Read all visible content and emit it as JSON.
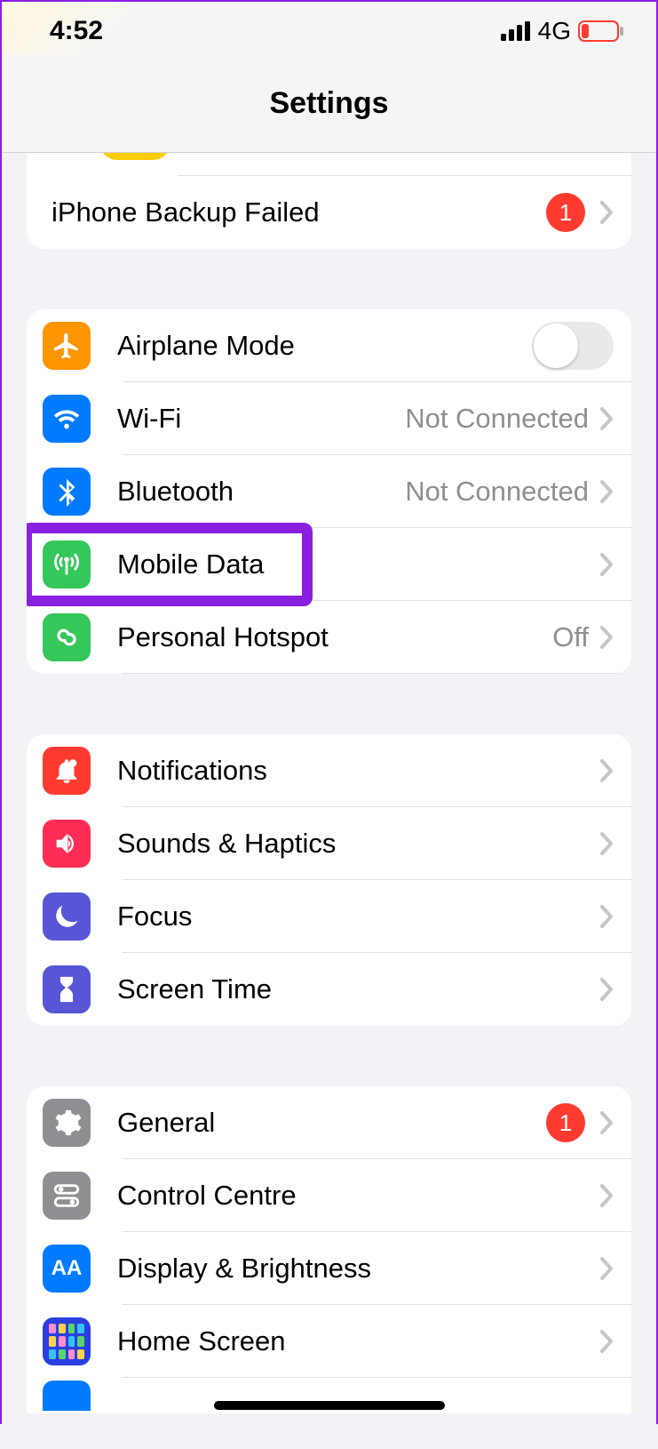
{
  "status_bar": {
    "time": "4:52",
    "network_label": "4G"
  },
  "header": {
    "title": "Settings"
  },
  "first_group": {
    "backup": {
      "label": "iPhone Backup Failed",
      "badge": "1"
    }
  },
  "connectivity": {
    "airplane": {
      "label": "Airplane Mode"
    },
    "wifi": {
      "label": "Wi-Fi",
      "value": "Not Connected"
    },
    "bluetooth": {
      "label": "Bluetooth",
      "value": "Not Connected"
    },
    "mobile": {
      "label": "Mobile Data"
    },
    "hotspot": {
      "label": "Personal Hotspot",
      "value": "Off"
    }
  },
  "alerts": {
    "notifications": {
      "label": "Notifications"
    },
    "sounds": {
      "label": "Sounds & Haptics"
    },
    "focus": {
      "label": "Focus"
    },
    "screentime": {
      "label": "Screen Time"
    }
  },
  "general_group": {
    "general": {
      "label": "General",
      "badge": "1"
    },
    "control": {
      "label": "Control Centre"
    },
    "display": {
      "label": "Display & Brightness"
    },
    "home": {
      "label": "Home Screen"
    }
  }
}
